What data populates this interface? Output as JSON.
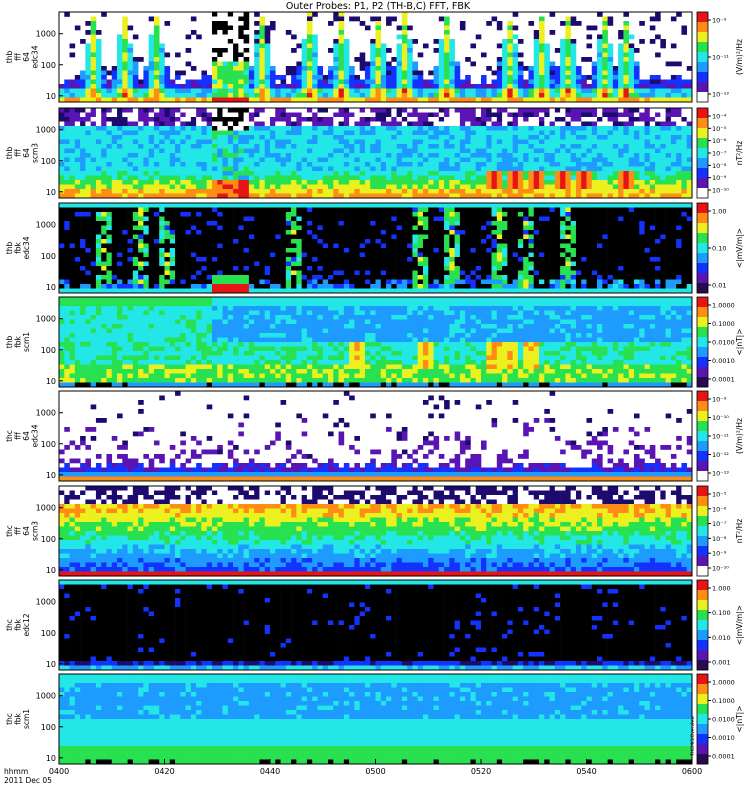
{
  "chart_data": {
    "type": "heatmap",
    "title": "Outer Probes: P1, P2 (TH-B,C) FFT, FBK",
    "x_axis": {
      "ticks": [
        "0400",
        "0420",
        "0440",
        "0500",
        "0520",
        "0540",
        "0600"
      ],
      "row_label": "hhmm",
      "date_label": "2011 Dec 05"
    },
    "panels": [
      {
        "ylabel": [
          "thb",
          "fff",
          "64",
          "edc34"
        ],
        "yticks": [
          "1000",
          "100",
          "10"
        ],
        "cbar_title": "(V/m)²/Hz",
        "cbar_ticks": [
          "10⁻⁹",
          "10⁻¹¹",
          "10⁻¹³"
        ],
        "style": "efield_sparse",
        "features": [
          {
            "kind": "block",
            "t_start_min": 29,
            "t_end_min": 35
          },
          {
            "kind": "bursts",
            "t_min": [
              6,
              12,
              18,
              38,
              47,
              53,
              60,
              65,
              73,
              85,
              91,
              96,
              103,
              107
            ]
          }
        ]
      },
      {
        "ylabel": [
          "thb",
          "fff",
          "64",
          "scm3"
        ],
        "yticks": [
          "1000",
          "100",
          "10"
        ],
        "cbar_title": "nT²/Hz",
        "cbar_ticks": [
          "10⁻⁴",
          "10⁻⁵",
          "10⁻⁶",
          "10⁻⁷",
          "10⁻⁸",
          "10⁻⁹",
          "10⁻¹⁰"
        ],
        "style": "bfield_dense",
        "features": [
          {
            "kind": "block",
            "t_start_min": 29,
            "t_end_min": 35
          },
          {
            "kind": "chorus",
            "t_min": [
              82,
              86,
              90,
              95,
              99,
              107
            ]
          }
        ]
      },
      {
        "ylabel": [
          "thb",
          "fbk",
          "edc34"
        ],
        "yticks": [
          "1000",
          "100",
          "10"
        ],
        "cbar_title": "<|mV/m|>",
        "cbar_ticks": [
          "1.00",
          "0.10",
          "0.01"
        ],
        "style": "fbk_e",
        "features": [
          {
            "kind": "block",
            "t_start_min": 29,
            "t_end_min": 35
          },
          {
            "kind": "bursts",
            "t_min": [
              8,
              15,
              20,
              44,
              68,
              74,
              83,
              88,
              96
            ]
          }
        ]
      },
      {
        "ylabel": [
          "thb",
          "fbk",
          "scm1"
        ],
        "yticks": [
          "1000",
          "100",
          "10"
        ],
        "cbar_title": "<|nT|>",
        "cbar_ticks": [
          "1.0000",
          "0.1000",
          "0.0100",
          "0.0010",
          "0.0001"
        ],
        "style": "fbk_b",
        "features": [
          {
            "kind": "transition",
            "t_min": 29
          },
          {
            "kind": "bursts",
            "t_min": [
              56,
              69,
              82,
              85,
              89
            ]
          }
        ]
      },
      {
        "ylabel": [
          "thc",
          "fff",
          "64",
          "edc34"
        ],
        "yticks": [
          "1000",
          "100",
          "10"
        ],
        "cbar_title": "(V/m)²/Hz",
        "cbar_ticks": [
          "10⁻⁹",
          "10⁻¹⁰",
          "10⁻¹¹",
          "10⁻¹²",
          "10⁻¹³"
        ],
        "style": "efield_spiky",
        "features": []
      },
      {
        "ylabel": [
          "thc",
          "fff",
          "64",
          "scm3"
        ],
        "yticks": [
          "1000",
          "100",
          "10"
        ],
        "cbar_title": "nT²/Hz",
        "cbar_ticks": [
          "10⁻⁵",
          "10⁻⁶",
          "10⁻⁷",
          "10⁻⁸",
          "10⁻⁹",
          "10⁻¹⁰"
        ],
        "style": "bfield_uniform",
        "features": []
      },
      {
        "ylabel": [
          "thc",
          "fbk",
          "edc12"
        ],
        "yticks": [
          "1000",
          "100",
          "10"
        ],
        "cbar_title": "<|mV/m|>",
        "cbar_ticks": [
          "1.000",
          "0.100",
          "0.010",
          "0.001"
        ],
        "style": "fbk_e_quiet",
        "features": []
      },
      {
        "ylabel": [
          "thc",
          "fbk",
          "scm1"
        ],
        "yticks": [
          "1000",
          "100",
          "10"
        ],
        "cbar_title": "<|nT|>",
        "cbar_ticks": [
          "1.0000",
          "0.1000",
          "0.0100",
          "0.0010",
          "0.0001"
        ],
        "style": "fbk_b_uniform",
        "features": []
      }
    ],
    "footer_stamp": "THEMIS/Overview"
  },
  "colors": {
    "black": "#000000",
    "navy": "#1c0a6e",
    "purple": "#5a14b4",
    "blue": "#1432ff",
    "skyblue": "#1e9bff",
    "cyan": "#23e6e6",
    "green": "#28e150",
    "yellow": "#ebf01e",
    "orange": "#ff8c14",
    "red": "#e61414"
  }
}
